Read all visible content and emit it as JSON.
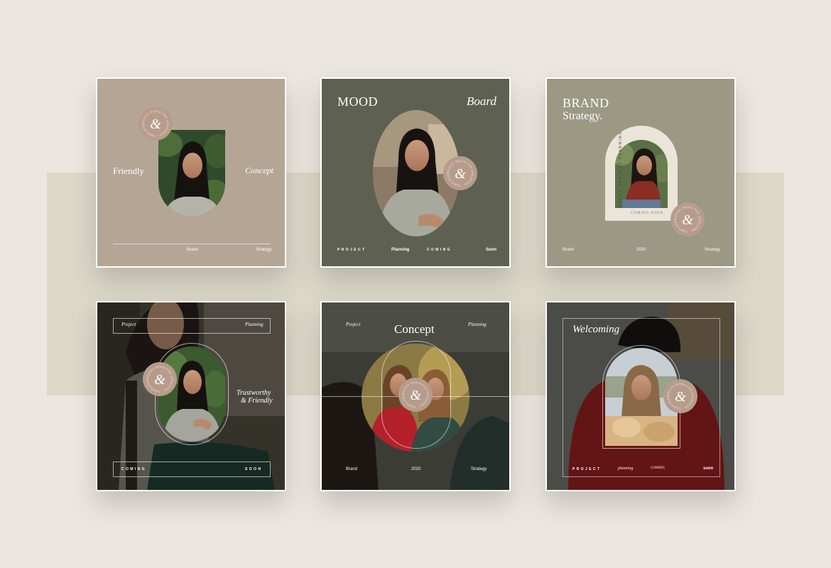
{
  "colors": {
    "page_bg": "#ebe7e0",
    "band": "#dcd9c9",
    "card1": "#b5a595",
    "card2": "#5e6151",
    "card3": "#9b9884",
    "arch_cream": "#ebe5d9",
    "badge": "#b79c8c"
  },
  "badge": {
    "glyph": "&",
    "ring_text": "SOCIAL MEDIA FOR CREATORS · TEMPLATES ·"
  },
  "cards": [
    {
      "left_label": "Friendly",
      "right_label": "Concept",
      "footer": [
        "Brand",
        "Strategy"
      ]
    },
    {
      "title_left": "MOOD",
      "title_right": "Board",
      "footer": [
        "PROJECT",
        "Planning",
        "COMING",
        "Soon"
      ]
    },
    {
      "title_line1": "BRAND",
      "title_line2": "Strategy.",
      "arch_text": "ABOUT PROJECT PLANNING",
      "arch_caption": "COMING SOON",
      "footer": [
        "Brand",
        "2020",
        "Strategy"
      ]
    },
    {
      "top_left": "Project",
      "top_right": "Planning",
      "side_line1": "Trustworthy",
      "side_line2": "& Friendly",
      "bottom_left": "COMING",
      "bottom_right": "SOON"
    },
    {
      "top_left": "Project",
      "title": "Concept",
      "top_right": "Planning",
      "footer": [
        "Brand",
        "2020",
        "Strategy"
      ]
    },
    {
      "title": "Welcoming",
      "footer": [
        "PROJECT",
        "planning",
        "COMING",
        "soon"
      ]
    }
  ]
}
